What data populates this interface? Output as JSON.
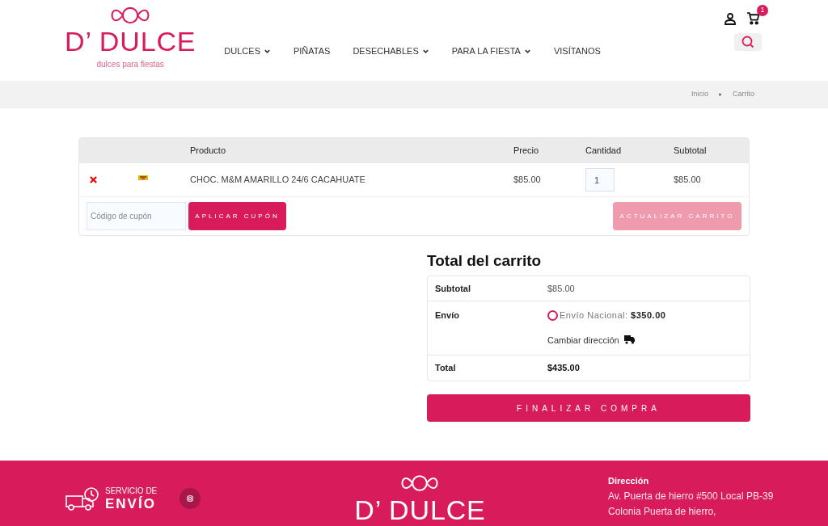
{
  "header": {
    "logo": {
      "name": "D’ DULCE",
      "tagline": "dulces para fiestas"
    },
    "nav": [
      {
        "label": "DULCES",
        "dropdown": true
      },
      {
        "label": "PIÑATAS",
        "dropdown": false
      },
      {
        "label": "DESECHABLES",
        "dropdown": true
      },
      {
        "label": "PARA LA FIESTA",
        "dropdown": true
      },
      {
        "label": "VISÍTANOS",
        "dropdown": false
      }
    ],
    "cart_count": "1"
  },
  "breadcrumb": [
    "Inicio",
    "Carrito"
  ],
  "cart_table": {
    "columns": [
      "Producto",
      "Precio",
      "Cantidad",
      "Subtotal"
    ],
    "rows": [
      {
        "product": "CHOC. M&M AMARILLO 24/6 CACAHUATE",
        "price": "$85.00",
        "quantity": "1",
        "subtotal": "$85.00"
      }
    ],
    "coupon": {
      "placeholder": "Código de cupón",
      "button": "APLICAR CUPÓN"
    },
    "update_button": {
      "label": "ACTUALIZAR CARRITO",
      "disabled": true
    }
  },
  "totals": {
    "title": "Total del carrito",
    "subtotal_label": "Subtotal",
    "subtotal": "$85.00",
    "shipping_label": "Envío",
    "shipping_option": {
      "label": "Envío Nacional:",
      "price": "$350.00",
      "selected": false
    },
    "change_address": "Cambiar dirección",
    "total_label": "Total",
    "total": "$435.00",
    "checkout": "FINALIZAR COMPRA"
  },
  "footer": {
    "service_small": "SERVICIO DE",
    "service_big": "ENVÍO",
    "logo": "D’ DULCE",
    "address_title": "Dirección",
    "address_lines": [
      "Av. Puerta de hierro #500 Local PB-39",
      "Colonia Puerta de hierro,"
    ]
  }
}
